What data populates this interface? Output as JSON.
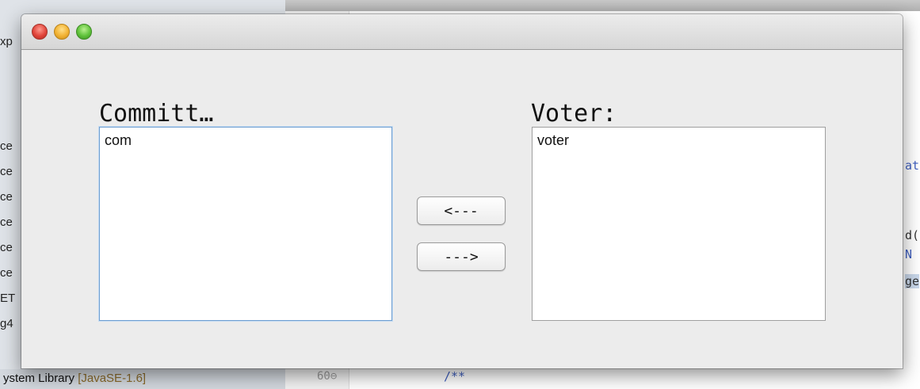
{
  "background": {
    "tree_fragments": [
      "xp",
      "ce",
      "ce",
      "ce",
      "ce",
      "ce",
      "ce",
      "ET",
      "g4"
    ],
    "status_text": "ystem Library ",
    "status_jre": "[JavaSE-1.6]",
    "line_number": "60⊖",
    "code_comment": "/**",
    "editor_fragments": [
      "at",
      "d(",
      "N",
      "ge"
    ]
  },
  "window": {
    "left_heading": "Committ…",
    "right_heading": "Voter:",
    "left_list": [
      "com"
    ],
    "right_list": [
      "voter"
    ],
    "move_left_label": "<---",
    "move_right_label": "--->"
  },
  "titlebar_buttons": {
    "close_color": "#e0443a",
    "minimize_color": "#f2b233",
    "zoom_color": "#5fc23a"
  }
}
